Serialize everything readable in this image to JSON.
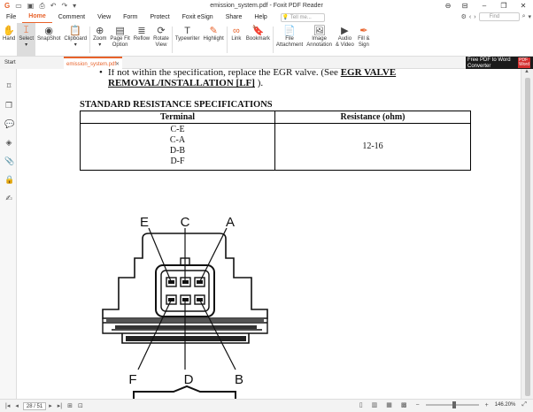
{
  "window": {
    "title": "emission_system.pdf - Foxit PDF Reader"
  },
  "menu": {
    "items": [
      "File",
      "Home",
      "Comment",
      "View",
      "Form",
      "Protect",
      "Foxit eSign",
      "Share",
      "Help"
    ],
    "active": "Home",
    "tell_me_placeholder": "Tell me...",
    "find_placeholder": "Find"
  },
  "ribbon": {
    "hand": "Hand",
    "select": "Select",
    "snapshot": "SnapShot",
    "clipboard": "Clipboard",
    "zoom": "Zoom",
    "page_fit": "Page Fit\nOption",
    "reflow": "Reflow",
    "rotate": "Rotate\nView",
    "typewriter": "Typewriter",
    "highlight": "Highlight",
    "link": "Link",
    "bookmark": "Bookmark",
    "file_attachment": "File\nAttachment",
    "image_annotation": "Image\nAnnotation",
    "audio_video": "Audio\n& Video",
    "fill_sign": "Fill &\nSign"
  },
  "tabs": {
    "start": "Start",
    "document": "emission_system.pdf"
  },
  "promo": {
    "line1": "Free PDF to Word",
    "line2": "Converter",
    "badge_top": "PDF",
    "badge_bottom": "Word"
  },
  "document": {
    "bullet_text": "If not within the specification, replace the EGR valve. (See ",
    "bullet_link": "EGR VALVE",
    "bullet_link2": "REMOVAL/INSTALLATION [LF]",
    "bullet_end": " ).",
    "section_title": "STANDARD RESISTANCE SPECIFICATIONS",
    "table": {
      "headers": [
        "Terminal",
        "Resistance (ohm)"
      ],
      "terminals": [
        "C-E",
        "C-A",
        "D-B",
        "D-F"
      ],
      "resistance": "12-16"
    },
    "diagram_labels": {
      "E": "E",
      "C": "C",
      "A": "A",
      "F": "F",
      "D": "D",
      "B": "B"
    }
  },
  "status": {
    "page": "28 / 51",
    "zoom": "146.20%"
  }
}
